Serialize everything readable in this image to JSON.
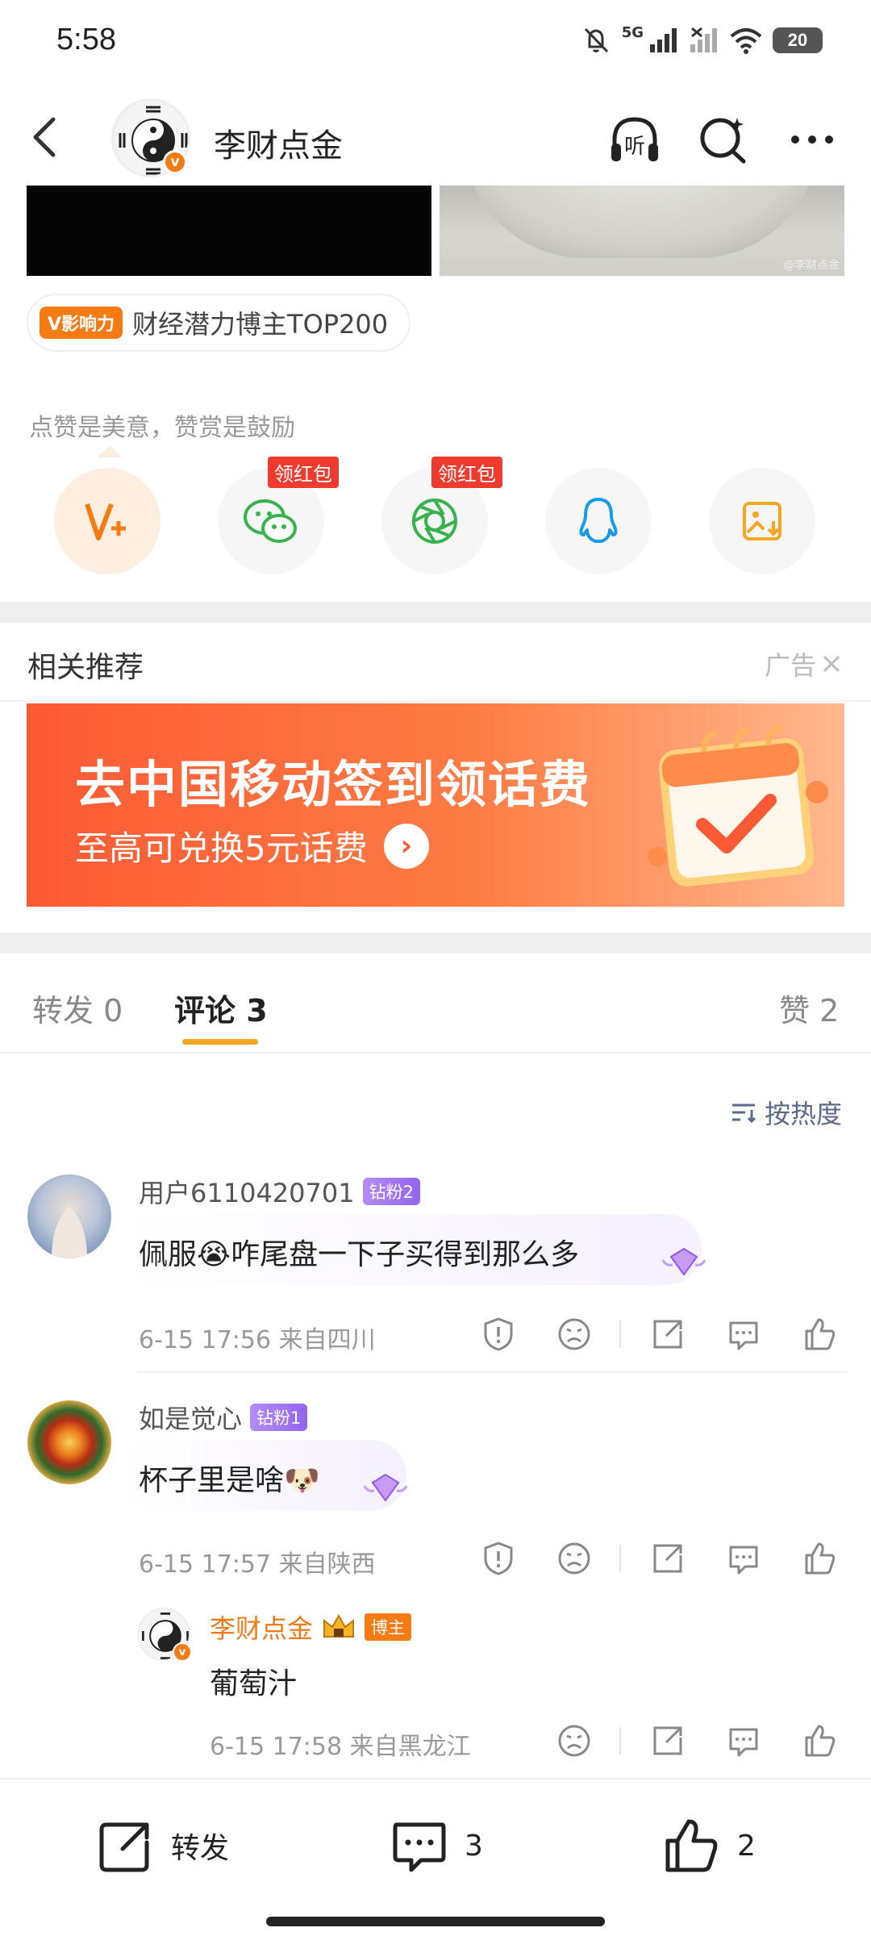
{
  "status_bar": {
    "time": "5:58",
    "network": "5G",
    "battery": "20"
  },
  "header": {
    "account_name": "李财点金",
    "verified_badge": "v",
    "listen_icon_label": "听"
  },
  "post": {
    "image_watermark": "@李财点金",
    "influence_badge": "V影响力",
    "influence_text": "财经潜力博主TOP200",
    "reward_hint": "点赞是美意，赞赏是鼓励",
    "share_targets": [
      {
        "name": "v-plus-icon",
        "tag": ""
      },
      {
        "name": "wechat-icon",
        "tag": "领红包"
      },
      {
        "name": "moments-icon",
        "tag": "领红包"
      },
      {
        "name": "qq-icon",
        "tag": ""
      },
      {
        "name": "save-image-icon",
        "tag": ""
      }
    ]
  },
  "recommend": {
    "title": "相关推荐",
    "ad_label": "广告",
    "banner_title": "去中国移动签到领话费",
    "banner_sub": "至高可兑换5元话费"
  },
  "tabs": [
    {
      "label": "转发 0"
    },
    {
      "label": "评论 3"
    },
    {
      "label": "赞 2"
    }
  ],
  "sort_label": "按热度",
  "comments": [
    {
      "user": "用户6110420701",
      "badge": "钻粉2",
      "text": "佩服😭咋尾盘一下子买得到那么多",
      "meta": "6-15 17:56  来自四川"
    },
    {
      "user": "如是觉心",
      "badge": "钻粉1",
      "text": "杯子里是啥🐶",
      "meta": "6-15 17:57  来自陕西"
    },
    {
      "user": "李财点金",
      "badge": "博主",
      "text": "葡萄汁",
      "meta": "6-15 17:58  来自黑龙江"
    }
  ],
  "bottom_bar": {
    "repost_label": "转发",
    "comment_count": "3",
    "like_count": "2"
  },
  "colors": {
    "accent": "#f57c15",
    "tab_underline": "#f5a623",
    "fan_badge": "#9365ee",
    "red_tag": "#ef3b2f"
  }
}
